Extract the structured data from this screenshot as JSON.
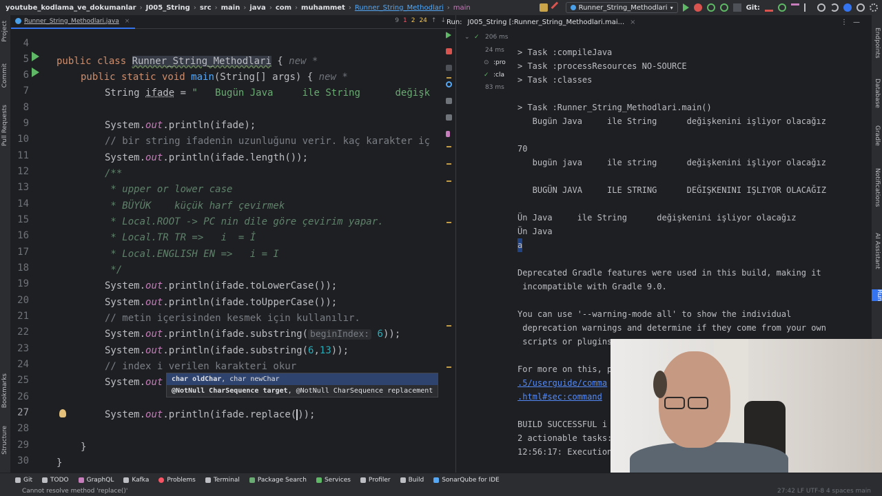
{
  "breadcrumb": [
    "youtube_kodlama_ve_dokumanlar",
    "J005_String",
    "src",
    "main",
    "java",
    "com",
    "muhammet",
    "Runner_String_Methodlari",
    "main"
  ],
  "toolbar": {
    "run_config": "Runner_String_Methodlari",
    "git_label": "Git:"
  },
  "left_tools": [
    "Project",
    "Commit",
    "Pull Requests",
    "Bookmarks",
    "Structure"
  ],
  "right_tools": [
    "Endpoints",
    "Database",
    "Gradle",
    "Notifications",
    "AI Assistant",
    "Run"
  ],
  "editor": {
    "tab": "Runner_String_Methodlari.java",
    "inspections": {
      "hidden": "9",
      "errors": "1",
      "warnings_a": "2",
      "warnings_b": "24"
    },
    "line_numbers": [
      "4",
      "5",
      "6",
      "7",
      "8",
      "9",
      "10",
      "11",
      "12",
      "13",
      "14",
      "15",
      "16",
      "17",
      "18",
      "19",
      "20",
      "21",
      "22",
      "23",
      "24",
      "25",
      "26",
      "27",
      "28",
      "29",
      "30"
    ],
    "completion": {
      "row1": {
        "param1": "char oldChar",
        "sep": ", char newChar"
      },
      "row2": {
        "param1": "@NotNull CharSequence target",
        "sep": ", @NotNull CharSequence replacement"
      }
    }
  },
  "code": {
    "l5_kw": "public class ",
    "l5_cls": "Runner_String_Methodlari",
    "l5_rest": " {",
    "l5_hint": " new *",
    "l6_kw": "public static void ",
    "l6_fn": "main",
    "l6_rest": "(String[] args) {",
    "l6_hint": " new *",
    "l7_type": "String ",
    "l7_var": "ifade",
    "l7_eq": " = ",
    "l7_str": "\"   Bugün Java     ile String      değişk",
    "sys": "System.",
    "out": "out",
    "l9_rest": ".println(ifade);",
    "l10_cm": "// bir string ifadenin uzunluğunu verir. kaç karakter iç",
    "l11_rest": ".println(ifade.length());",
    "l12_doc": "/**",
    "l13_doc": " * upper or lower case",
    "l14_doc": " * BÜYÜK    küçük harf çevirmek",
    "l15_doc": " * Local.ROOT -> PC nin dile göre çevirim yapar.",
    "l16_doc": " * Local.TR TR =>   i  = İ",
    "l17_doc": " * Local.ENGLISH EN =>   i = I",
    "l18_doc": " */",
    "l19_rest": ".println(ifade.toLowerCase());",
    "l20_rest": ".println(ifade.toUpperCase());",
    "l21_cm": "// metin içerisinden kesmek için kullanılır.",
    "l22_a": ".println(ifade.substring(",
    "l22_hint": "beginIndex:",
    "l22_num": " 6",
    "l22_b": "));",
    "l23_a": ".println(ifade.substring(",
    "l23_n1": "6",
    "l23_c": ",",
    "l23_n2": "13",
    "l23_b": "));",
    "l24_cm": "// index i verilen karakteri okur",
    "l27_a": ".println(ifade.replace(",
    "l27_b": ")",
    "l27_c": ");",
    "close1": "}",
    "close2": "}"
  },
  "run": {
    "label": "Run:",
    "tab": "J005_String [:Runner_String_Methodlari.mai...",
    "tree": {
      "root_time": "206 ms",
      "t1": ":pro",
      "t1_time": "24 ms",
      "t2": ":cla",
      "t2_time": "83 ms"
    },
    "console": [
      "> Task :compileJava",
      "> Task :processResources NO-SOURCE",
      "> Task :classes",
      "",
      "> Task :Runner_String_Methodlari.main()",
      "   Bugün Java     ile String      değişkenini işliyor olacağız",
      "",
      "70",
      "   bugün java     ile string      değişkenini işliyor olacağız",
      "",
      "   BUGÜN JAVA     ILE STRING      DEĞIŞKENINI IŞLIYOR OLACAĞIZ",
      "",
      "Ün Java     ile String      değişkenini işliyor olacağız",
      "Ün Java",
      "a",
      "",
      "Deprecated Gradle features were used in this build, making it",
      " incompatible with Gradle 9.0.",
      "",
      "You can use '--warning-mode all' to show the individual",
      " deprecation warnings and determine if they come from your own",
      " scripts or plugins",
      "",
      "For more on this, p",
      ".5/userguide/comma",
      ".html#sec:command",
      "",
      "BUILD SUCCESSFUL i",
      "2 actionable tasks:",
      "12:56:17: Execution"
    ]
  },
  "bottom_tools": [
    "Git",
    "TODO",
    "GraphQL",
    "Kafka",
    "Problems",
    "Terminal",
    "Package Search",
    "Services",
    "Profiler",
    "Build",
    "SonarQube for IDE"
  ],
  "status": {
    "message": "Cannot resolve method 'replace()'",
    "right": "27:42  LF  UTF-8  4 spaces  main"
  }
}
